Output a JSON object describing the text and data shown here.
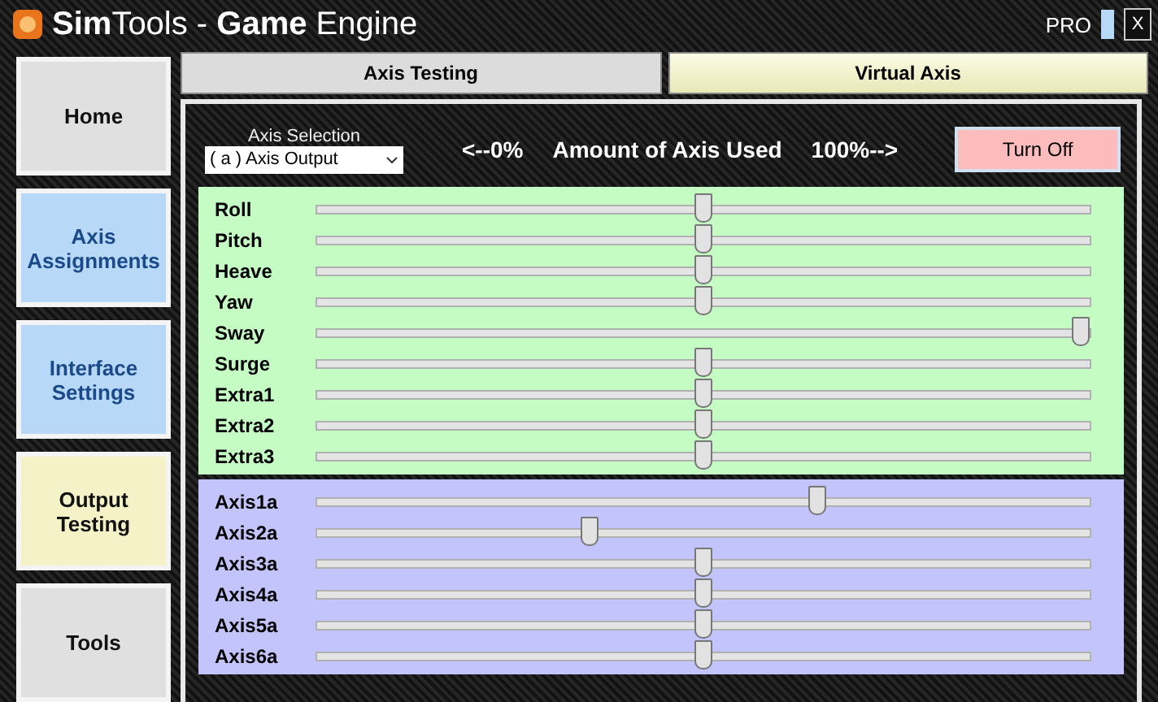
{
  "window": {
    "title_bold": "Sim",
    "title_rest": "Tools - ",
    "title_bold2": "Game",
    "title_rest2": " Engine",
    "edition": "PRO",
    "close": "X"
  },
  "sidebar": [
    {
      "label": "Home",
      "color": "#e0e0e0"
    },
    {
      "label": "Axis Assignments",
      "color": "#b8d8f8"
    },
    {
      "label": "Interface Settings",
      "color": "#b8d8f8"
    },
    {
      "label": "Output Testing",
      "color": "#f6f2c8"
    },
    {
      "label": "Tools",
      "color": "#e0e0e0"
    }
  ],
  "tabs": [
    {
      "label": "Axis Testing",
      "selected": false
    },
    {
      "label": "Virtual Axis",
      "selected": true
    }
  ],
  "axis_selection": {
    "label": "Axis Selection",
    "value": "( a ) Axis Output"
  },
  "scale": {
    "left": "<--0%",
    "middle": "Amount of Axis Used",
    "right": "100%-->"
  },
  "turn_off_button": "Turn Off",
  "groups": [
    {
      "color": "#c4fcc4",
      "sliders": [
        {
          "name": "Roll",
          "level": 0.5
        },
        {
          "name": "Pitch",
          "level": 0.5
        },
        {
          "name": "Heave",
          "level": 0.5
        },
        {
          "name": "Yaw",
          "level": 0.5
        },
        {
          "name": "Sway",
          "level": 1
        },
        {
          "name": "Surge",
          "level": 0.5
        },
        {
          "name": "Extra1",
          "level": 0.5
        },
        {
          "name": "Extra2",
          "level": 0.5
        },
        {
          "name": "Extra3",
          "level": 0.5
        }
      ]
    },
    {
      "color": "#c4c4fc",
      "sliders": [
        {
          "name": "Axis1a",
          "level": 0.65
        },
        {
          "name": "Axis2a",
          "level": 0.35
        },
        {
          "name": "Axis3a",
          "level": 0.5
        },
        {
          "name": "Axis4a",
          "level": 0.5
        },
        {
          "name": "Axis5a",
          "level": 0.5
        },
        {
          "name": "Axis6a",
          "level": 0.5
        }
      ]
    }
  ]
}
